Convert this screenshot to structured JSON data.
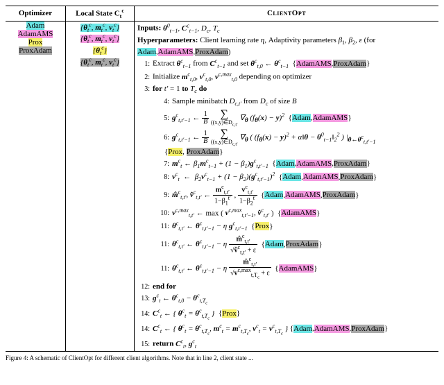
{
  "headers": {
    "optimizer": "Optimizer",
    "local_state": "Local State C",
    "local_state_sup": "c",
    "local_state_sub": "t",
    "clientopt": "ClientOpt"
  },
  "optimizers": [
    {
      "name": "Adam",
      "class": "hl-cyan",
      "state": "{θ_t^c, m_t^c, v_t^c}"
    },
    {
      "name": "AdamAMS",
      "class": "hl-mag",
      "state": "{θ_t^c, m_t^c, v_t^c}"
    },
    {
      "name": "Prox",
      "class": "hl-yel",
      "state": "{θ_t^c}"
    },
    {
      "name": "ProxAdam",
      "class": "hl-gray",
      "state": "{θ_t^c, m_t^c, v_t^c}"
    }
  ],
  "alg": {
    "inputs_label": "Inputs:",
    "inputs_val": " θ_{t−1}^0, C_{t−1}^c, D_c, T_c",
    "hparams_label": "Hyperparameters:",
    "hparams_val": " Client learning rate η, Adaptivity parameters β₁, β₂, ε (for ",
    "hparams_tags": [
      "Adam",
      "AdamAMS",
      "ProxAdam"
    ],
    "l1a": "Extract θ_{t−1}^c from C_{t−1}^c and set θ_{t,0}^c ← θ_{t−1}^c  {",
    "l1tags": [
      "AdamAMS",
      "ProxAdam"
    ],
    "l1b": "}",
    "l2": "Initialize m_{t,0}^c, v_{t,0}^c, v_{t,0}^{c,max} depending on optimizer",
    "l3": "for t′ = 1 to T_c do",
    "l4": "Sample minibatch D_{c,t′} from D_c of size B",
    "l5a": "g_{t,t′−1}^c ←  (1/B)  Σ_{(x,y)∈D_{c,t′}} ∇_θ (f_θ(x) − y)²  {",
    "l5tags": [
      "Adam",
      "AdamAMS"
    ],
    "l5b": "}",
    "l6a": "g_{t,t′−1}^c ←  (1/B)  Σ_{(x,y)∈D_{c,t′}} ∇_θ ( (f_θ(x) − y)² + α‖θ − θ_{t−1}^0‖₂² ) |_{θ←θ_{t,t′−1}^c}",
    "l6tags": [
      "Prox",
      "ProxAdam"
    ],
    "l7a": "m_t^c ← β₁ m_{t−1}^c + (1 − β₁) g_{t,t′−1}^c  {",
    "l7tags": [
      "Adam",
      "AdamAMS",
      "ProxAdam"
    ],
    "l7b": "}",
    "l8a": "v_t^c  ←  β₂ v_{t−1}^c  + (1 − β₂)(g_{t,t′−1}^c)²  {",
    "l8tags": [
      "Adam",
      "AdamAMS",
      "ProxAdam"
    ],
    "l8b": "}",
    "l9a": "m̂_{t,t′}^c, v̂_{t,t′}^c ←  m_{t,t′}^c / (1 − β₁^{t′}) ,  v_{t,t′}^c / (1 − β₂^{t′})  {",
    "l9tags": [
      "Adam",
      "AdamAMS",
      "ProxAdam"
    ],
    "l9b": "}",
    "l10a": "v_{t,t′}^{c,max} ← max ( v_{t,t′−1}^{c,max}, v̂_{t,t′}^c )  {",
    "l10tags": [
      "AdamAMS"
    ],
    "l10b": "}",
    "l11pa": "θ_{t,t′}^c ← θ_{t,t′−1}^c − η g_{t,t′−1}^c  {",
    "l11ptags": [
      "Prox"
    ],
    "l11pb": "}",
    "l11aa": "θ_{t,t′}^c ← θ_{t,t′−1}^c − η  m̂_{t,t′}^c / (√(v̂_{t,t′}^c) + ε)  {",
    "l11atags": [
      "Adam",
      "ProxAdam"
    ],
    "l11ab": "}",
    "l11ba": "θ_{t,t′}^c ← θ_{t,t′−1}^c − η  m̂_{t,t′}^c / (√(v_{t,T_c}^{c,max}) + ε)  {",
    "l11btags": [
      "AdamAMS"
    ],
    "l11bb": "}",
    "l12": "end for",
    "l13": "g_t^c ← θ_{t,0}^c − θ_{t,T_c}^c",
    "l14a": "C_t^c ← { θ_t^c = θ_{t,T_c}^c }  {",
    "l14tags": [
      "Prox"
    ],
    "l14b": "}",
    "l14ca": "C_t^c ← { θ_t^c = θ_{t,T_c}^c, m_t^c = m_{t,T_c}^c, v_t^c = v_{t,T_c}^c }  {",
    "l14ctags": [
      "Adam",
      "AdamAMS",
      "ProxAdam"
    ],
    "l14cb": "}",
    "l15": "return C_t^c, g_t^c"
  },
  "tag_class": {
    "Adam": "hl-cyan",
    "AdamAMS": "hl-mag",
    "Prox": "hl-yel",
    "ProxAdam": "hl-gray"
  },
  "caption": "Figure 4: A schematic of ClientOpt for different client algorithms. Note that in line 2, client state ..."
}
